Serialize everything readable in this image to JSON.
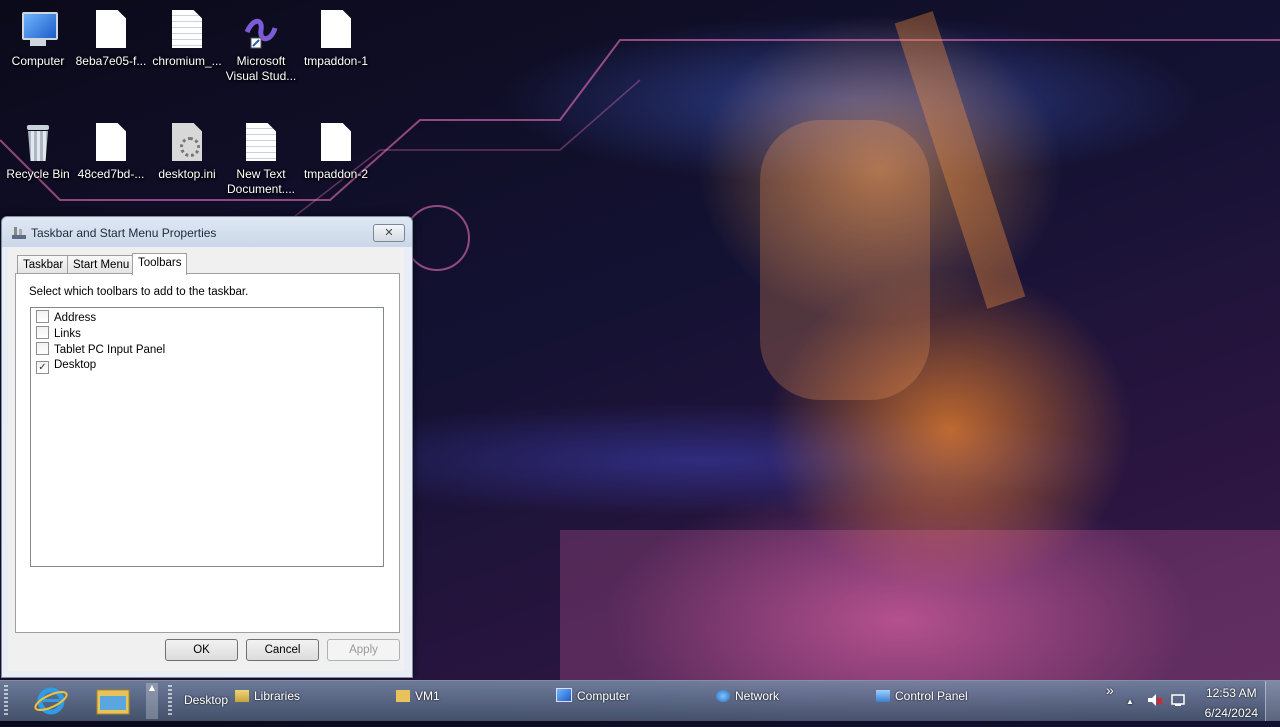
{
  "desktop_icons": [
    {
      "label": "Computer",
      "icon": "computer-icon"
    },
    {
      "label": "8eba7e05-f...",
      "icon": "file-icon"
    },
    {
      "label": "chromium_...",
      "icon": "file-icon"
    },
    {
      "label": "Microsoft Visual Stud...",
      "icon": "visual-studio-icon"
    },
    {
      "label": "tmpaddon-1",
      "icon": "file-icon"
    },
    {
      "label": "Recycle Bin",
      "icon": "recycle-bin-icon"
    },
    {
      "label": "48ced7bd-...",
      "icon": "file-icon"
    },
    {
      "label": "desktop.ini",
      "icon": "settings-file-icon"
    },
    {
      "label": "New Text Document....",
      "icon": "text-document-icon"
    },
    {
      "label": "tmpaddon-2",
      "icon": "file-icon"
    }
  ],
  "dialog": {
    "title": "Taskbar and Start Menu Properties",
    "close_label": "✕",
    "tabs": [
      {
        "label": "Taskbar"
      },
      {
        "label": "Start Menu"
      },
      {
        "label": "Toolbars"
      }
    ],
    "active_tab": "Toolbars",
    "description": "Select which toolbars to add to the taskbar.",
    "toolbars": [
      {
        "label": "Address",
        "checked": false
      },
      {
        "label": "Links",
        "checked": false
      },
      {
        "label": "Tablet PC Input Panel",
        "checked": false
      },
      {
        "label": "Desktop",
        "checked": true
      }
    ],
    "buttons": {
      "ok": "OK",
      "cancel": "Cancel",
      "apply": "Apply"
    }
  },
  "taskbar": {
    "desktop_toolbar_label": "Desktop",
    "items": [
      {
        "label": "Libraries",
        "icon": "libraries-icon"
      },
      {
        "label": "VM1",
        "icon": "folder-icon"
      },
      {
        "label": "Computer",
        "icon": "computer-icon"
      },
      {
        "label": "Network",
        "icon": "network-icon"
      },
      {
        "label": "Control Panel",
        "icon": "control-panel-icon"
      }
    ],
    "overflow": "»",
    "tray_arrow": "▲",
    "time": "12:53 AM",
    "date": "6/24/2024"
  },
  "colors": {
    "taskbar": "#5a6b85",
    "dialog_bg": "#f0f0f0",
    "accent": "#1e5fbf"
  }
}
